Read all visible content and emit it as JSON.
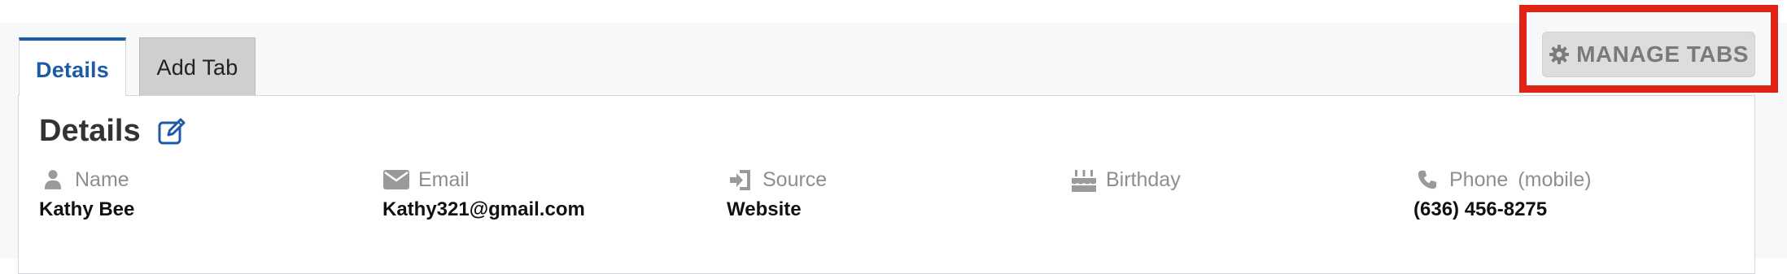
{
  "tabs": {
    "details_label": "Details",
    "add_label": "Add Tab"
  },
  "toolbar": {
    "manage_tabs_label": "MANAGE TABS"
  },
  "panel": {
    "title": "Details",
    "fields": {
      "name": {
        "label": "Name",
        "value": "Kathy Bee",
        "icon": "user-icon"
      },
      "email": {
        "label": "Email",
        "value": "Kathy321@gmail.com",
        "icon": "envelope-icon"
      },
      "source": {
        "label": "Source",
        "value": "Website",
        "icon": "sign-in-icon"
      },
      "birthday": {
        "label": "Birthday",
        "value": "",
        "icon": "birthday-cake-icon"
      },
      "phone": {
        "label": "Phone",
        "sublabel": "(mobile)",
        "value": "(636) 456-8275",
        "icon": "phone-icon"
      }
    }
  },
  "colors": {
    "accent": "#1d5aa8",
    "highlight": "#e02517",
    "label_gray": "#8e8e8e"
  }
}
